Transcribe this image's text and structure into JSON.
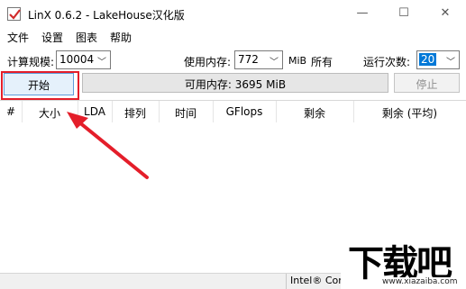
{
  "window": {
    "title": "LinX 0.6.2 - LakeHouse汉化版",
    "min_glyph": "—",
    "max_glyph": "☐",
    "close_glyph": "✕"
  },
  "menu": {
    "items": [
      {
        "label": "文件"
      },
      {
        "label": "设置"
      },
      {
        "label": "图表"
      },
      {
        "label": "帮助"
      }
    ]
  },
  "settings": {
    "size_label": "计算规模:",
    "size_value": "10004",
    "memory_label": "使用内存:",
    "memory_value": "772",
    "memory_unit": "MiB",
    "all_label": "所有",
    "runs_label": "运行次数:",
    "runs_value": "20"
  },
  "actions": {
    "start_label": "开始",
    "available_memory": "可用内存: 3695 MiB",
    "stop_label": "停止"
  },
  "table": {
    "columns": [
      "#",
      "大小",
      "LDA",
      "排列",
      "时间",
      "GFlops",
      "剩余",
      "剩余 (平均)"
    ]
  },
  "status": {
    "cpu": "Intel® Core"
  },
  "watermark": {
    "main": "下载吧",
    "sub": "www.xiazaiba.com"
  },
  "colors": {
    "highlight_box": "#e41e2a",
    "arrow": "#e41e2a",
    "select_focus": "#0078d7",
    "start_button_bg": "#e5f1fb"
  }
}
